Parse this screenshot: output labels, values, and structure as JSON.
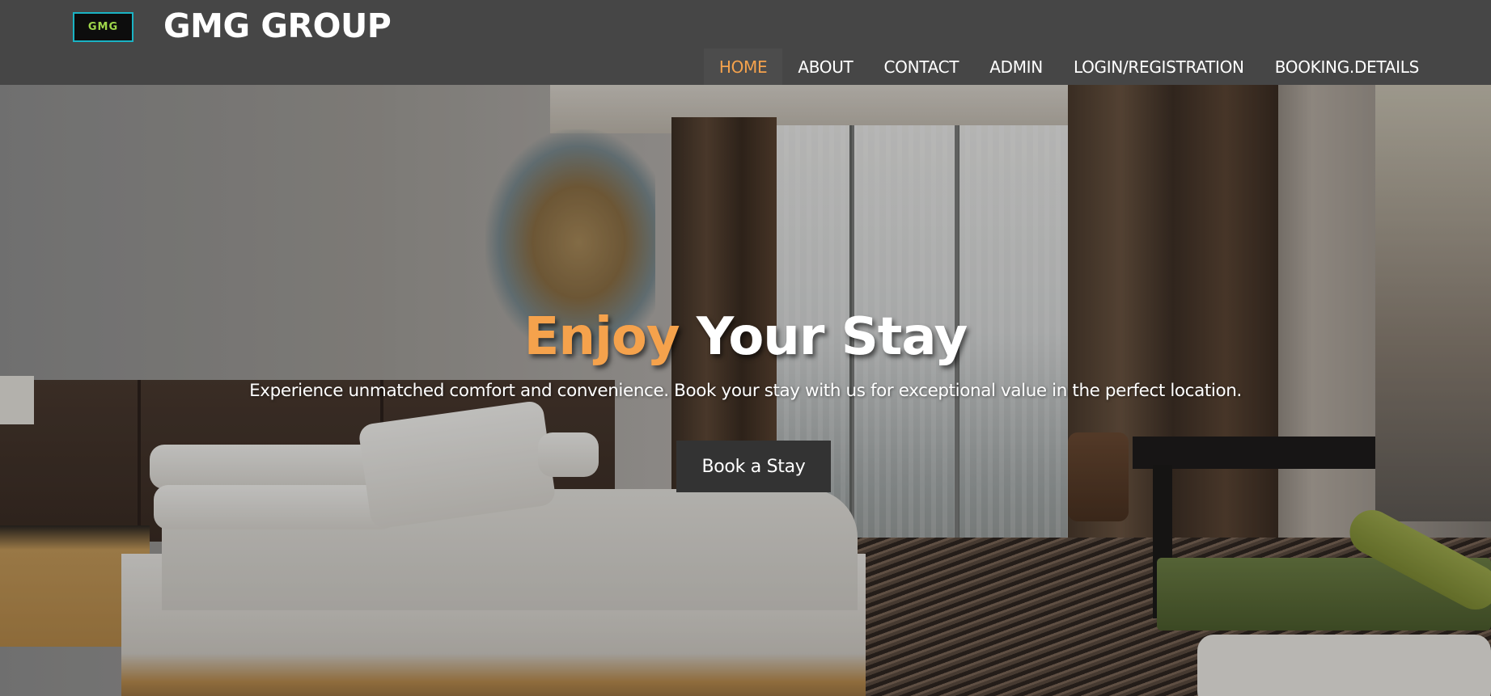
{
  "header": {
    "logo_text": "GMG",
    "brand": "GMG GROUP",
    "nav": [
      {
        "label": "HOME",
        "active": true
      },
      {
        "label": "ABOUT",
        "active": false
      },
      {
        "label": "CONTACT",
        "active": false
      },
      {
        "label": "ADMIN",
        "active": false
      },
      {
        "label": "LOGIN/REGISTRATION",
        "active": false
      },
      {
        "label": "BOOKING.DETAILS",
        "active": false
      }
    ]
  },
  "hero": {
    "title_accent": "Enjoy",
    "title_rest": "Your Stay",
    "subtitle": "Experience unmatched comfort and convenience. Book your stay with us for exceptional value in the perfect location.",
    "cta_label": "Book a Stay"
  },
  "colors": {
    "header_bg": "#464646",
    "accent": "#f5a24c",
    "cta_bg": "#333333",
    "logo_border": "#1ab3c4",
    "logo_text": "#9fd64a"
  }
}
